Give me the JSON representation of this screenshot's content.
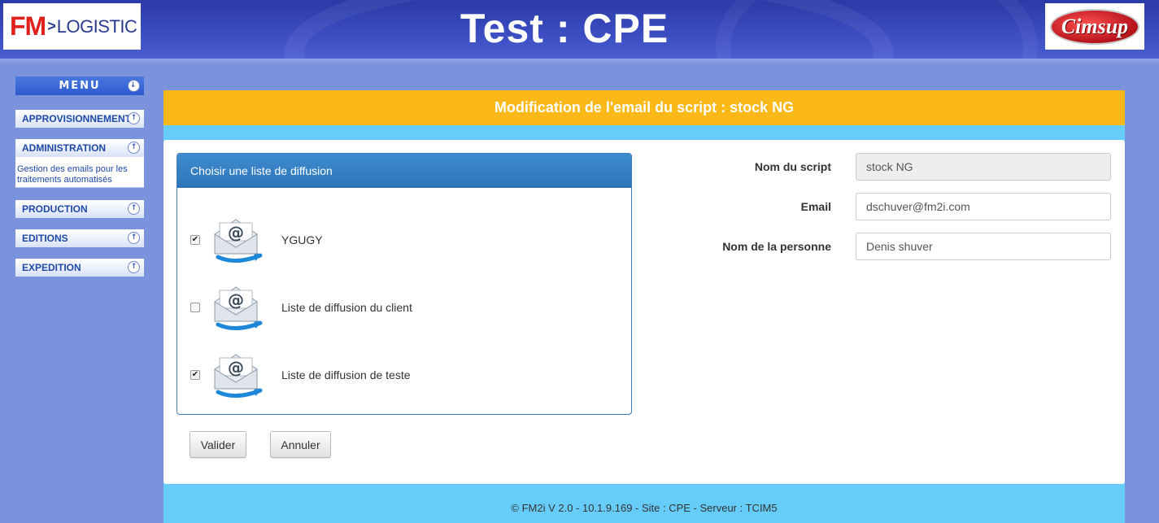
{
  "header": {
    "title": "Test : CPE",
    "logo_left": {
      "brand": "FM",
      "arrow": ">",
      "text": "LOGISTIC"
    },
    "logo_right": {
      "text": "Cimsup"
    }
  },
  "sidebar": {
    "menu_label": "MENU",
    "items": [
      {
        "label": "APPROVISIONNEMENT"
      },
      {
        "label": "ADMINISTRATION",
        "sub": "Gestion des emails pour les traitements automatisés"
      },
      {
        "label": "PRODUCTION"
      },
      {
        "label": "EDITIONS"
      },
      {
        "label": "EXPEDITION"
      }
    ]
  },
  "main": {
    "title": "Modification de l'email du script : stock NG",
    "panel": {
      "title": "Choisir une liste de diffusion",
      "lists": [
        {
          "label": "YGUGY",
          "checked": true
        },
        {
          "label": "Liste de diffusion du client",
          "checked": false
        },
        {
          "label": "Liste de diffusion de teste",
          "checked": true
        }
      ]
    },
    "buttons": {
      "validate": "Valider",
      "cancel": "Annuler"
    },
    "form": {
      "script_name_label": "Nom du script",
      "script_name_value": "stock NG",
      "email_label": "Email",
      "email_value": "dschuver@fm2i.com",
      "person_label": "Nom de la personne",
      "person_value": "Denis shuver"
    }
  },
  "footer": {
    "text": "© FM2i V 2.0 - 10.1.9.169 - Site : CPE - Serveur : TCIM5"
  },
  "colors": {
    "header": "#3a4cc0",
    "page_background": "#7b93dc",
    "title_bar": "#fbb819",
    "main_band": "#66ccfa",
    "panel_header": "#3f8ccf",
    "sidebar_text": "#1f49a8"
  }
}
